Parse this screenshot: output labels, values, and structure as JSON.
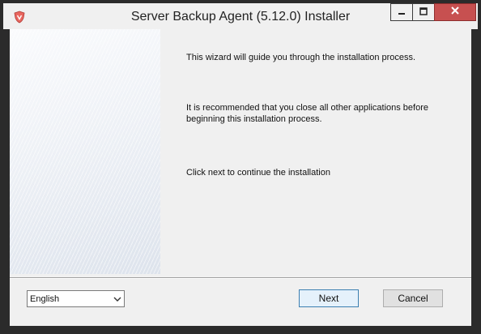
{
  "window": {
    "title": "Server Backup Agent (5.12.0) Installer"
  },
  "content": {
    "message_intro": "This wizard will guide you through the installation process.",
    "message_recommend": "It is recommended that you close all other applications before beginning this installation process.",
    "message_continue": "Click next to continue the installation"
  },
  "footer": {
    "language_selected": "English",
    "next_label": "Next",
    "cancel_label": "Cancel"
  },
  "icons": {
    "app": "shield-logo-icon",
    "minimize": "minimize-icon",
    "maximize": "maximize-icon",
    "close": "close-icon",
    "dropdown": "chevron-down-icon"
  },
  "colors": {
    "close_button": "#c75050",
    "app_logo": "#d9534f"
  }
}
